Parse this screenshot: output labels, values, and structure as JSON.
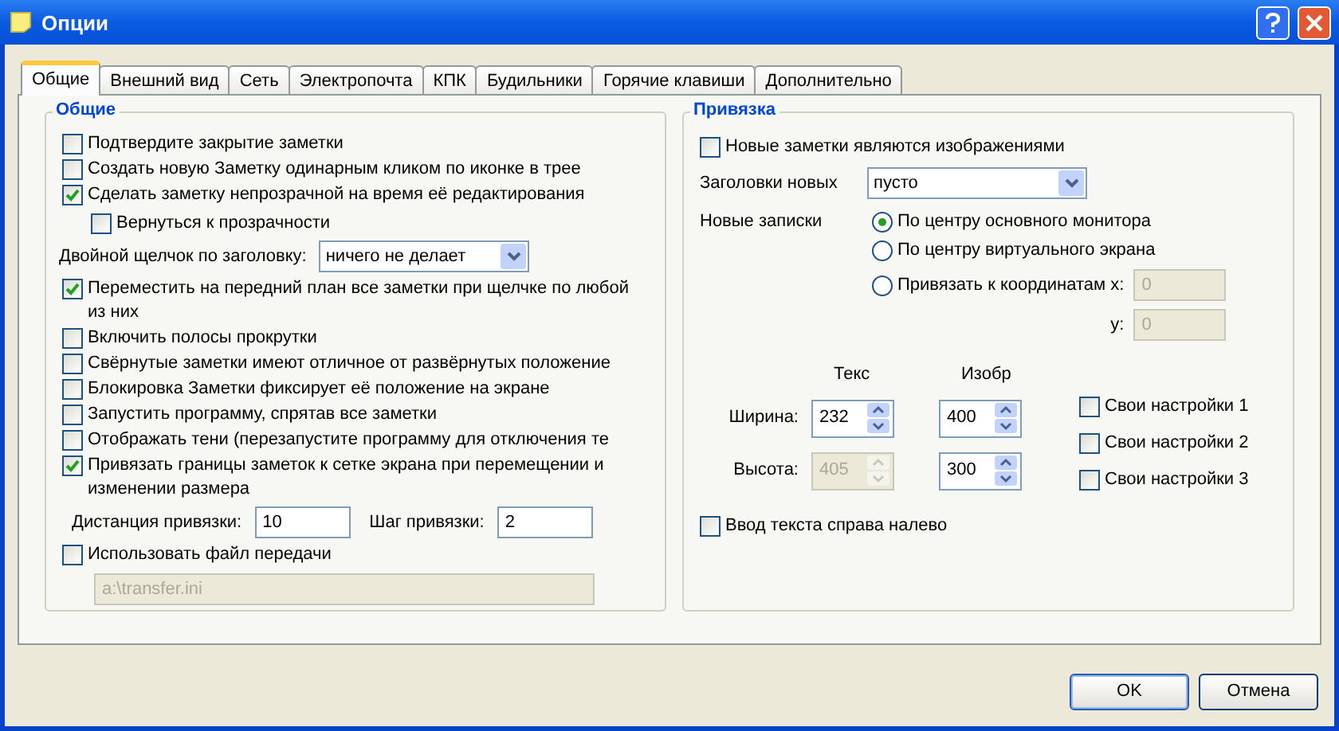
{
  "window": {
    "title": "Опции"
  },
  "tabs": [
    {
      "label": "Общие",
      "selected": true
    },
    {
      "label": "Внешний вид",
      "selected": false
    },
    {
      "label": "Сеть",
      "selected": false
    },
    {
      "label": "Электропочта",
      "selected": false
    },
    {
      "label": "КПК",
      "selected": false
    },
    {
      "label": "Будильники",
      "selected": false
    },
    {
      "label": "Горячие клавиши",
      "selected": false
    },
    {
      "label": "Дополнительно",
      "selected": false
    }
  ],
  "left_group": {
    "title": "Общие",
    "items": [
      {
        "kind": "checkbox",
        "label": "Подтвердите закрытие заметки",
        "checked": false
      },
      {
        "kind": "checkbox",
        "label": "Создать новую Заметку одинарным кликом по иконке в трее",
        "checked": false
      },
      {
        "kind": "checkbox",
        "label": "Сделать заметку непрозрачной на время её редактирования",
        "checked": true,
        "children": [
          {
            "kind": "checkbox",
            "label": "Вернуться к прозрачности",
            "checked": false
          }
        ]
      },
      {
        "kind": "dropdown",
        "label": "Двойной щелчок по заголовку:",
        "value": "ничего не делает"
      },
      {
        "kind": "checkbox",
        "label": "Переместить на передний план все заметки при щелчке по любой из них",
        "checked": true
      },
      {
        "kind": "checkbox",
        "label": "Включить полосы прокрутки",
        "checked": false
      },
      {
        "kind": "checkbox",
        "label": "Свёрнутые заметки имеют отличное от развёрнутых положение",
        "checked": false
      },
      {
        "kind": "checkbox",
        "label": "Блокировка Заметки фиксирует её положение на экране",
        "checked": false
      },
      {
        "kind": "checkbox",
        "label": "Запустить программу, спрятав все заметки",
        "checked": false
      },
      {
        "kind": "checkbox",
        "label": "Отображать тени (перезапустите программу для отключения те",
        "checked": false
      },
      {
        "kind": "checkbox",
        "label": "Привязать границы заметок к сетке экрана при перемещении и изменении размера",
        "checked": true
      },
      {
        "kind": "fields",
        "fields": [
          {
            "label": "Дистанция привязки:",
            "value": "10"
          },
          {
            "label": "Шаг привязки:",
            "value": "2"
          }
        ]
      },
      {
        "kind": "checkbox",
        "label": "Использовать файл передачи",
        "checked": false
      },
      {
        "kind": "path",
        "value": "a:\\transfer.ini",
        "disabled": true
      }
    ]
  },
  "right_group": {
    "title": "Привязка",
    "images_checkbox": {
      "label": "Новые заметки являются изображениями",
      "checked": false
    },
    "titles": {
      "label": "Заголовки новых",
      "value": "пусто"
    },
    "position": {
      "label": "Новые записки",
      "options": [
        {
          "label": "По центру основного монитора",
          "selected": true
        },
        {
          "label": "По центру виртуального экрана",
          "selected": false
        },
        {
          "label": "Привязать к координатам x:",
          "selected": false
        }
      ],
      "x": {
        "value": "0",
        "disabled": true
      },
      "y": {
        "label": "y:",
        "value": "0",
        "disabled": true
      }
    },
    "size": {
      "columns": [
        "Текс",
        "Изобр"
      ],
      "rows": [
        {
          "label": "Ширина:",
          "values": [
            {
              "value": "232",
              "disabled": false
            },
            {
              "value": "400",
              "disabled": false
            }
          ]
        },
        {
          "label": "Высота:",
          "values": [
            {
              "value": "405",
              "disabled": true
            },
            {
              "value": "300",
              "disabled": false
            }
          ]
        }
      ]
    },
    "custom": [
      {
        "label": "Свои настройки 1",
        "checked": false
      },
      {
        "label": "Свои настройки 2",
        "checked": false
      },
      {
        "label": "Свои настройки 3",
        "checked": false
      }
    ],
    "rtl_checkbox": {
      "label": "Ввод текста справа налево",
      "checked": false
    }
  },
  "buttons": [
    "OK",
    "Отмена"
  ]
}
